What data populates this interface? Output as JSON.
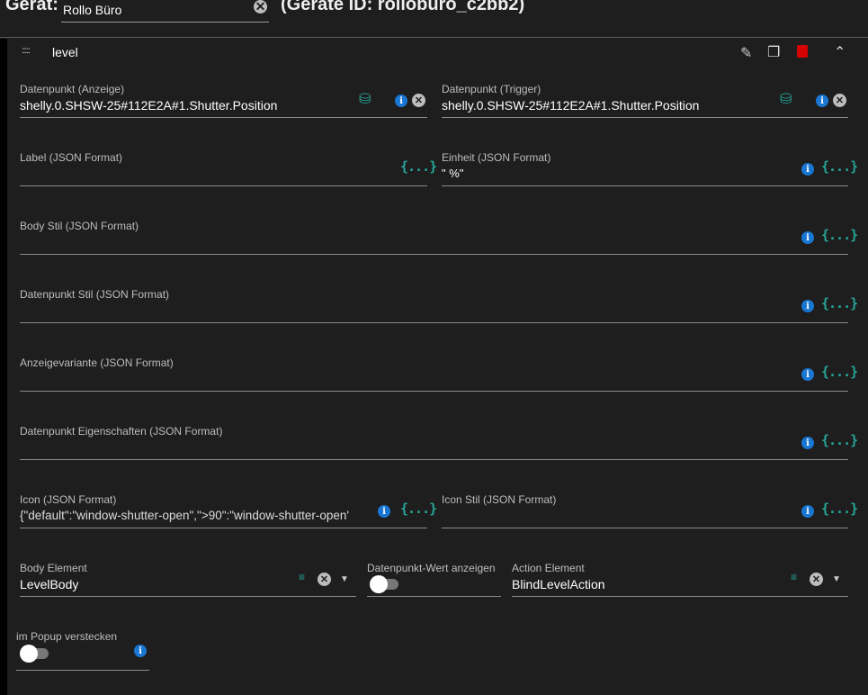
{
  "header": {
    "device_label": "Gerät:",
    "device_name": "Rollo Büro",
    "device_id": "(Geräte ID: rolloburo_c2bb2)"
  },
  "panel": {
    "title": "level"
  },
  "fields": {
    "dp_display": {
      "label": "Datenpunkt (Anzeige)",
      "value": "shelly.0.SHSW-25#112E2A#1.Shutter.Position"
    },
    "dp_trigger": {
      "label": "Datenpunkt (Trigger)",
      "value": "shelly.0.SHSW-25#112E2A#1.Shutter.Position"
    },
    "label": {
      "label": "Label (JSON Format)",
      "value": ""
    },
    "unit": {
      "label": "Einheit (JSON Format)",
      "value": "\" %\""
    },
    "body_style": {
      "label": "Body Stil (JSON Format)"
    },
    "dp_style": {
      "label": "Datenpunkt Stil (JSON Format)"
    },
    "display_variant": {
      "label": "Anzeigevariante (JSON Format)"
    },
    "dp_props": {
      "label": "Datenpunkt Eigenschaften (JSON Format)"
    },
    "icon": {
      "label": "Icon (JSON Format)",
      "value": "{\"default\":\"window-shutter-open\",\">90\":\"window-shutter-open'"
    },
    "icon_style": {
      "label": "Icon Stil (JSON Format)"
    },
    "body_element": {
      "label": "Body Element",
      "value": "LevelBody"
    },
    "show_value": {
      "label": "Datenpunkt-Wert anzeigen",
      "on": false
    },
    "action_element": {
      "label": "Action Element",
      "value": "BlindLevelAction"
    },
    "hide_popup": {
      "label": "im Popup verstecken",
      "on": false
    }
  },
  "glyphs": {
    "info": "i",
    "clear": "✕",
    "json": "{...}",
    "db": "⛁",
    "arrow": "▼",
    "drag": ":::::",
    "edit": "✎",
    "copy": "❐",
    "collapse": "⌃",
    "list": "≡"
  },
  "colors": {
    "accent": "#26a69a",
    "info": "#1976d2",
    "delete": "#d50000"
  }
}
